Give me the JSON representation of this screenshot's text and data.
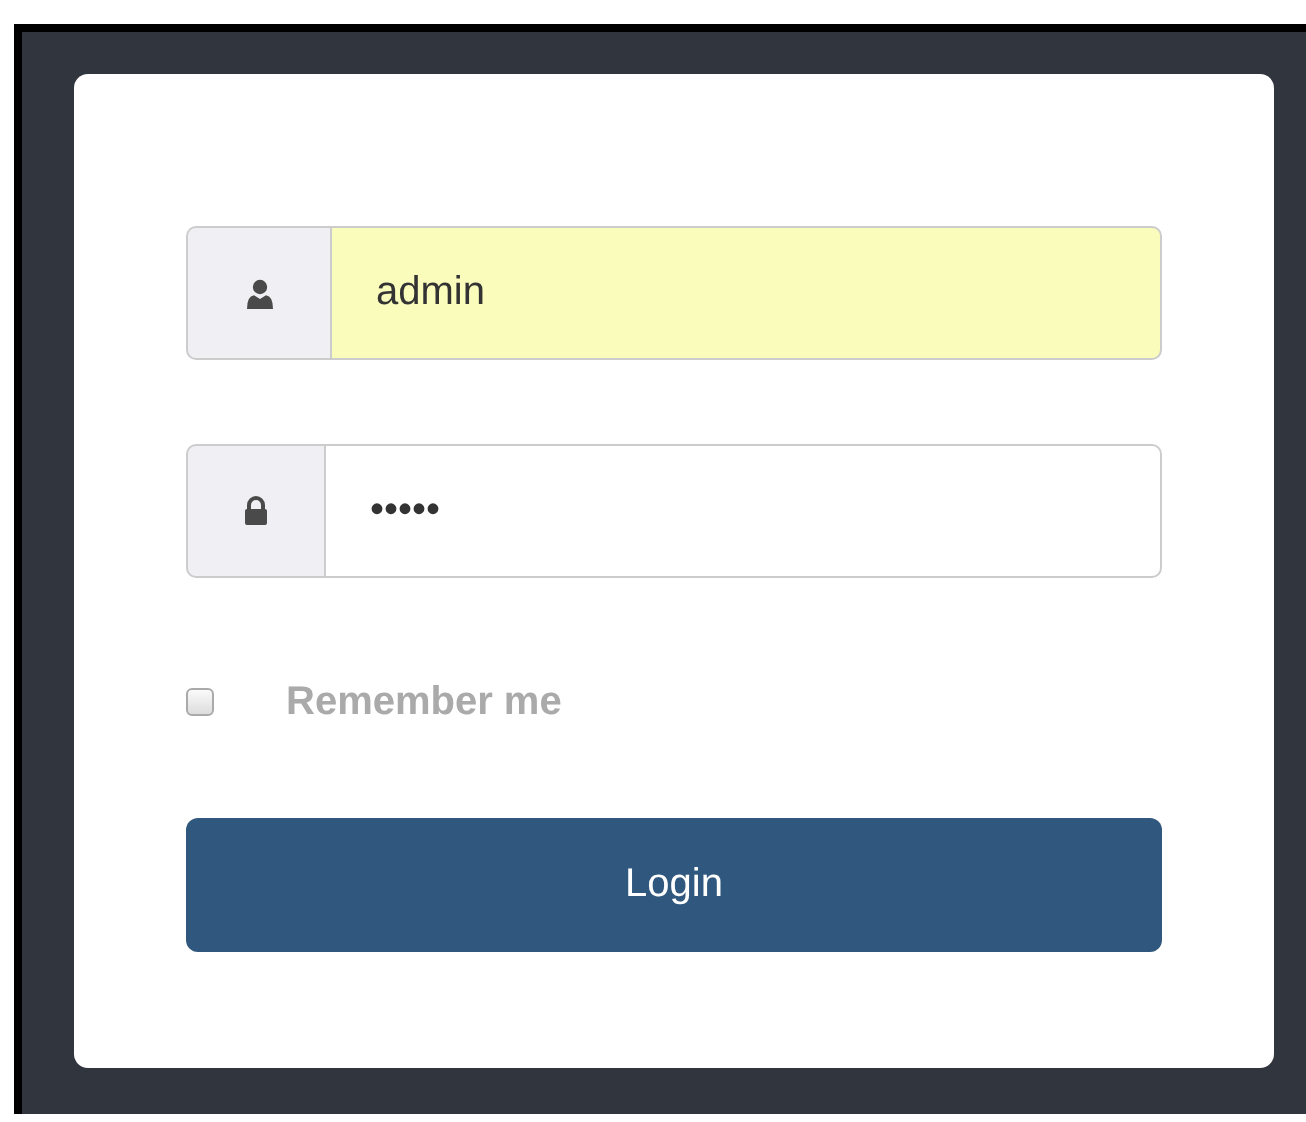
{
  "username_field": {
    "value": "admin",
    "autofilled": true
  },
  "password_field": {
    "value": "•••••",
    "autofilled": false
  },
  "remember_me": {
    "label": "Remember me",
    "checked": false
  },
  "login_button": {
    "label": "Login"
  }
}
